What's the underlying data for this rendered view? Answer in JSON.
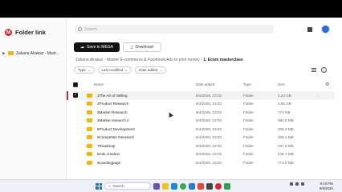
{
  "app": {
    "brand_mark": "M",
    "brand_text": "Folder link"
  },
  "sidebar": {
    "item_label": "Zakaria Alrakaz - Mast..."
  },
  "search": {
    "placeholder": "Search"
  },
  "toolbar": {
    "save_label": "Save to MEGA",
    "download_label": "Download"
  },
  "breadcrumb": {
    "parent": "Zakaria Alrakaz - Master E-commerce & Facebook Ads to print money",
    "separator": "›",
    "current": "1. Ecom masterclass"
  },
  "filters": {
    "type": "Type",
    "modified": "Last modified",
    "added": "Date added"
  },
  "table": {
    "headers": {
      "name": "Name",
      "date": "Date added",
      "type": "Type",
      "size": "Size"
    },
    "rows": [
      {
        "name": "1The Art of Selling",
        "date": "8/4/2025, 23:03",
        "type": "Folder",
        "size": "1.24 GB"
      },
      {
        "name": "2Product Research",
        "date": "8/4/2025, 23:03",
        "type": "Folder",
        "size": "3.85 GB"
      },
      {
        "name": "3Market Research",
        "date": "8/4/2025, 23:03",
        "type": "Folder",
        "size": "774 GB"
      },
      {
        "name": "4Market research 2",
        "date": "8/4/2025, 23:03",
        "type": "Folder",
        "size": "384.6 MB"
      },
      {
        "name": "5Product Development",
        "date": "8/4/2025, 23:03",
        "type": "Folder",
        "size": "205.2 MB"
      },
      {
        "name": "6Competitor Research",
        "date": "8/4/2025, 23:03",
        "type": "Folder",
        "size": "209.1 MB"
      },
      {
        "name": "7Roadmap",
        "date": "8/4/2025, 23:03",
        "type": "Folder",
        "size": "237.6 MB"
      },
      {
        "name": "8Ads creation",
        "date": "8/4/2025, 23:03",
        "type": "Folder",
        "size": "449.7 MB"
      },
      {
        "name": "9Landingpage",
        "date": "8/4/2025, 23:03",
        "type": "Folder",
        "size": "773.0 MB"
      }
    ]
  },
  "taskbar": {
    "search_label": "Search",
    "time": "9:10 PM",
    "date": "8/5/2025"
  }
}
